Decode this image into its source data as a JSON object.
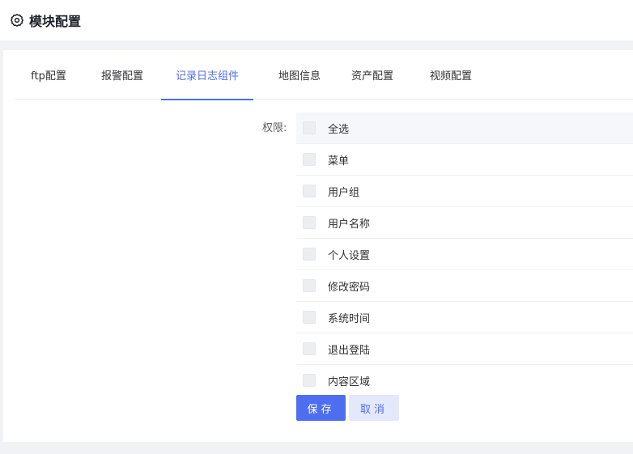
{
  "header": {
    "title": "模块配置",
    "icon": "gear-icon"
  },
  "tabs": [
    {
      "label": "ftp配置",
      "active": false
    },
    {
      "label": "报警配置",
      "active": false
    },
    {
      "label": "记录日志组件",
      "active": true
    },
    {
      "label": "地图信息",
      "active": false
    },
    {
      "label": "资产配置",
      "active": false
    },
    {
      "label": "视频配置",
      "active": false
    }
  ],
  "permissions": {
    "label": "权限:",
    "items": [
      {
        "label": "全选",
        "checked": false
      },
      {
        "label": "菜单",
        "checked": false
      },
      {
        "label": "用户组",
        "checked": false
      },
      {
        "label": "用户名称",
        "checked": false
      },
      {
        "label": "个人设置",
        "checked": false
      },
      {
        "label": "修改密码",
        "checked": false
      },
      {
        "label": "系统时间",
        "checked": false
      },
      {
        "label": "退出登陆",
        "checked": false
      },
      {
        "label": "内容区域",
        "checked": false
      }
    ]
  },
  "actions": {
    "save_label": "保存",
    "cancel_label": "取消"
  },
  "colors": {
    "accent": "#4e6ef2",
    "cancel_bg": "#e3e9fb",
    "background": "#f0f2f5"
  }
}
